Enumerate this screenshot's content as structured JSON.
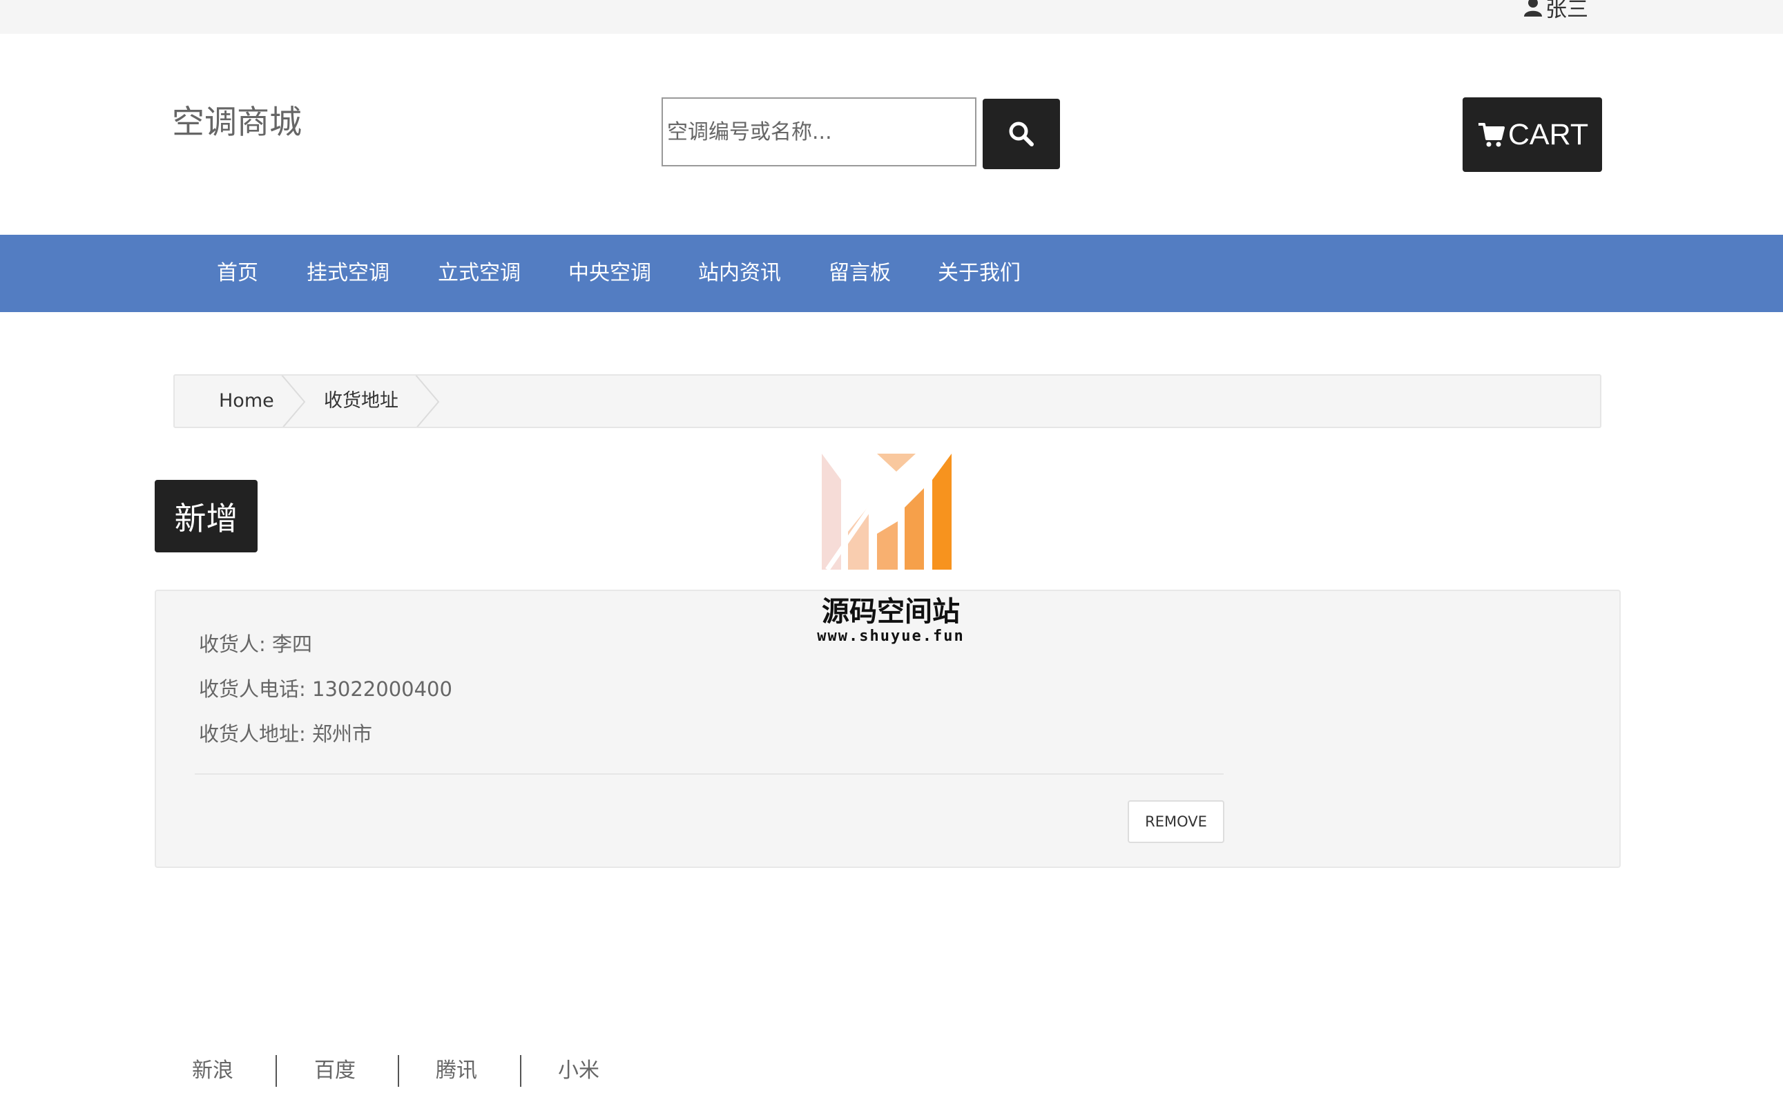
{
  "topbar": {
    "username": "张三",
    "user_icon": "user-icon"
  },
  "header": {
    "logo": "空调商城",
    "search": {
      "placeholder": "空调编号或名称...",
      "value": "",
      "icon": "search-icon"
    },
    "cart": {
      "label": "CART",
      "icon": "cart-icon"
    }
  },
  "nav": {
    "items": [
      {
        "label": "首页"
      },
      {
        "label": "挂式空调"
      },
      {
        "label": "立式空调"
      },
      {
        "label": "中央空调"
      },
      {
        "label": "站内资讯"
      },
      {
        "label": "留言板"
      },
      {
        "label": "关于我们"
      }
    ]
  },
  "breadcrumb": {
    "items": [
      "Home",
      "收货地址"
    ]
  },
  "actions": {
    "add_label": "新增"
  },
  "address": {
    "name_line": "收货人: 李四",
    "phone_line": "收货人电话: 13022000400",
    "addr_line": "收货人地址: 郑州市",
    "remove_label": "REMOVE"
  },
  "watermark": {
    "title": "源码空间站",
    "url": "www.shuyue.fun"
  },
  "footer": {
    "links": [
      "新浪",
      "百度",
      "腾讯",
      "小米"
    ]
  },
  "colors": {
    "nav_bg": "#537dc2",
    "button_dark": "#222222",
    "panel_bg": "#f5f5f5",
    "watermark_orange": "#f7931e"
  }
}
